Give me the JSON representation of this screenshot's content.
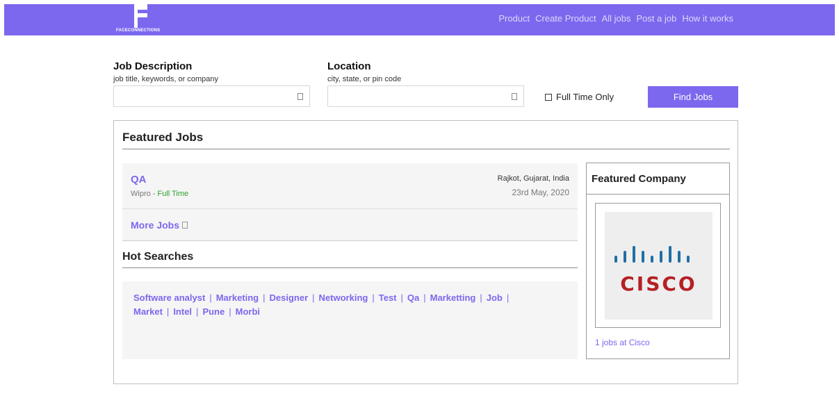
{
  "brand": {
    "name": "FACECONNECTIONS"
  },
  "nav": [
    "Product",
    "Create Product",
    "All jobs",
    "Post a job",
    "How it works"
  ],
  "search": {
    "job_label": "Job Description",
    "job_hint": "job title, keywords, or company",
    "location_label": "Location",
    "location_hint": "city, state, or pin code",
    "full_time_label": "Full Time Only",
    "submit_label": "Find Jobs"
  },
  "featured_jobs": {
    "title": "Featured Jobs",
    "jobs": [
      {
        "title": "QA",
        "company": "Wipro",
        "type": "Full Time",
        "location": "Rajkot, Gujarat, India",
        "date": "23rd May, 2020"
      }
    ],
    "more_label": "More Jobs"
  },
  "hot_searches": {
    "title": "Hot Searches",
    "items": [
      "Software analyst",
      "Marketing",
      "Designer",
      "Networking",
      "Test",
      "Qa",
      "Marketting",
      "Job",
      "Market",
      "Intel",
      "Pune",
      "Morbi"
    ]
  },
  "featured_company": {
    "title": "Featured Company",
    "logo_word": "CISCO",
    "jobs_link": "1 jobs at Cisco"
  },
  "colors": {
    "accent": "#7b68ee",
    "full_time": "#2e9d2e",
    "cisco_red": "#b52025",
    "cisco_blue": "#1f6fa3"
  }
}
